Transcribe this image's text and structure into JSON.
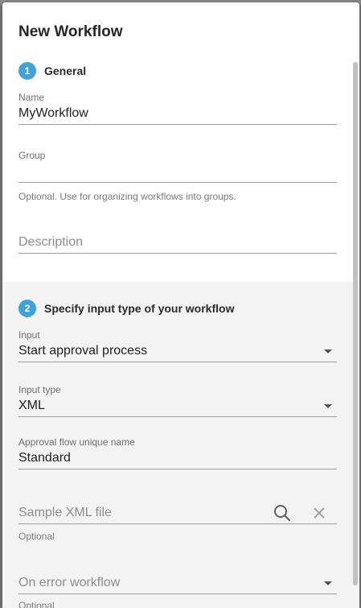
{
  "dialog": {
    "title": "New Workflow"
  },
  "section1": {
    "number": "1",
    "title": "General",
    "name": {
      "label": "Name",
      "value": "MyWorkflow"
    },
    "group": {
      "label": "Group",
      "value": "",
      "helper": "Optional. Use for organizing workflows into groups."
    },
    "description": {
      "placeholder": "Description"
    }
  },
  "section2": {
    "number": "2",
    "title": "Specify input type of your workflow",
    "input": {
      "label": "Input",
      "value": "Start approval process"
    },
    "input_type": {
      "label": "Input type",
      "value": "XML"
    },
    "approval_flow": {
      "label": "Approval flow unique name",
      "value": "Standard"
    },
    "sample_xml": {
      "placeholder": "Sample XML file",
      "helper": "Optional"
    },
    "on_error": {
      "placeholder": "On error workflow",
      "helper": "Optional"
    }
  },
  "colors": {
    "accent": "#3fa3d9",
    "section_bg": "#f3f3f3"
  },
  "icons": {
    "search": "search-icon",
    "clear": "close-icon",
    "dropdown": "chevron-down-icon"
  }
}
